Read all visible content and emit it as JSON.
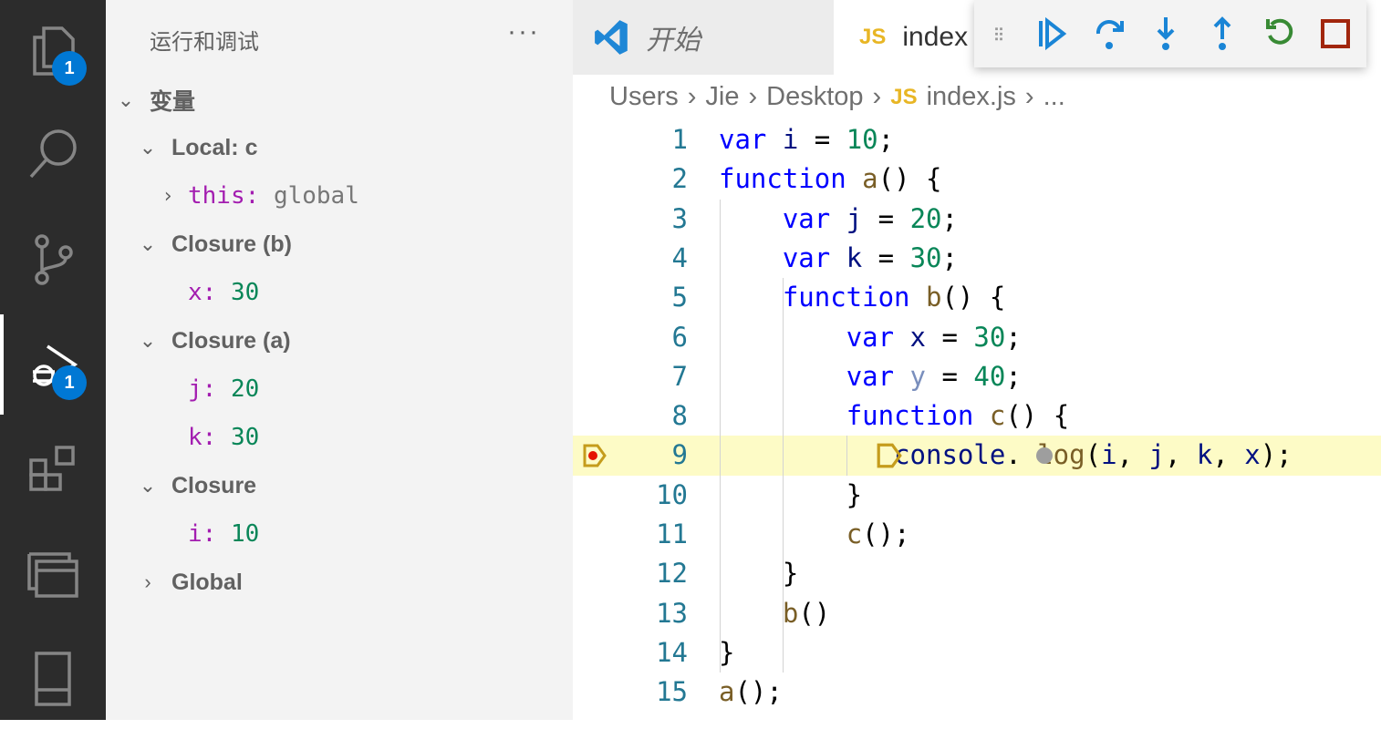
{
  "activity_bar": {
    "explorer_badge": "1",
    "debug_badge": "1"
  },
  "sidebar": {
    "title": "运行和调试",
    "more": "···",
    "section": "变量",
    "scopes": [
      {
        "label": "Local: c",
        "expanded": true,
        "vars": [
          {
            "name": "this",
            "value": "global",
            "expandable": true
          }
        ]
      },
      {
        "label": "Closure (b)",
        "expanded": true,
        "vars": [
          {
            "name": "x",
            "value": "30"
          }
        ]
      },
      {
        "label": "Closure (a)",
        "expanded": true,
        "vars": [
          {
            "name": "j",
            "value": "20"
          },
          {
            "name": "k",
            "value": "30"
          }
        ]
      },
      {
        "label": "Closure",
        "expanded": true,
        "vars": [
          {
            "name": "i",
            "value": "10"
          }
        ]
      },
      {
        "label": "Global",
        "expanded": false,
        "vars": []
      }
    ]
  },
  "tabs": [
    {
      "label": "开始"
    },
    {
      "label": "index",
      "icon": "JS"
    }
  ],
  "breadcrumb": [
    "Users",
    "Jie",
    "Desktop",
    "index.js",
    "..."
  ],
  "breadcrumb_icon": "JS",
  "debug_toolbar": [
    "continue",
    "step-over",
    "step-into",
    "step-out",
    "restart",
    "stop"
  ],
  "current_line": 9,
  "code": [
    [
      [
        "k",
        "var"
      ],
      [
        "p",
        " "
      ],
      [
        "v",
        "i"
      ],
      [
        "p",
        " = "
      ],
      [
        "n",
        "10"
      ],
      [
        "p",
        ";"
      ]
    ],
    [
      [
        "k",
        "function"
      ],
      [
        "p",
        " "
      ],
      [
        "f",
        "a"
      ],
      [
        "p",
        "() {"
      ]
    ],
    [
      [
        "p",
        "    "
      ],
      [
        "k",
        "var"
      ],
      [
        "p",
        " "
      ],
      [
        "v",
        "j"
      ],
      [
        "p",
        " = "
      ],
      [
        "n",
        "20"
      ],
      [
        "p",
        ";"
      ]
    ],
    [
      [
        "p",
        "    "
      ],
      [
        "k",
        "var"
      ],
      [
        "p",
        " "
      ],
      [
        "v",
        "k"
      ],
      [
        "p",
        " = "
      ],
      [
        "n",
        "30"
      ],
      [
        "p",
        ";"
      ]
    ],
    [
      [
        "p",
        "    "
      ],
      [
        "k",
        "function"
      ],
      [
        "p",
        " "
      ],
      [
        "f",
        "b"
      ],
      [
        "p",
        "() {"
      ]
    ],
    [
      [
        "p",
        "        "
      ],
      [
        "k",
        "var"
      ],
      [
        "p",
        " "
      ],
      [
        "v",
        "x"
      ],
      [
        "p",
        " = "
      ],
      [
        "n",
        "30"
      ],
      [
        "p",
        ";"
      ]
    ],
    [
      [
        "p",
        "        "
      ],
      [
        "k",
        "var"
      ],
      [
        "p",
        " "
      ],
      [
        "u",
        "y"
      ],
      [
        "p",
        " = "
      ],
      [
        "n",
        "40"
      ],
      [
        "p",
        ";"
      ]
    ],
    [
      [
        "p",
        "        "
      ],
      [
        "k",
        "function"
      ],
      [
        "p",
        " "
      ],
      [
        "f",
        "c"
      ],
      [
        "p",
        "() {"
      ]
    ],
    [
      [
        "p",
        "           "
      ],
      [
        "v",
        "console"
      ],
      [
        "p",
        "."
      ],
      [
        "p",
        " "
      ],
      [
        "f",
        "log"
      ],
      [
        "p",
        "("
      ],
      [
        "v",
        "i"
      ],
      [
        "p",
        ", "
      ],
      [
        "v",
        "j"
      ],
      [
        "p",
        ", "
      ],
      [
        "v",
        "k"
      ],
      [
        "p",
        ", "
      ],
      [
        "v",
        "x"
      ],
      [
        "p",
        ");"
      ]
    ],
    [
      [
        "p",
        "        }"
      ]
    ],
    [
      [
        "p",
        "        "
      ],
      [
        "f",
        "c"
      ],
      [
        "p",
        "();"
      ]
    ],
    [
      [
        "p",
        "    }"
      ]
    ],
    [
      [
        "p",
        "    "
      ],
      [
        "f",
        "b"
      ],
      [
        "p",
        "()"
      ]
    ],
    [
      [
        "p",
        "}"
      ]
    ],
    [
      [
        "f",
        "a"
      ],
      [
        "p",
        "();"
      ]
    ]
  ]
}
